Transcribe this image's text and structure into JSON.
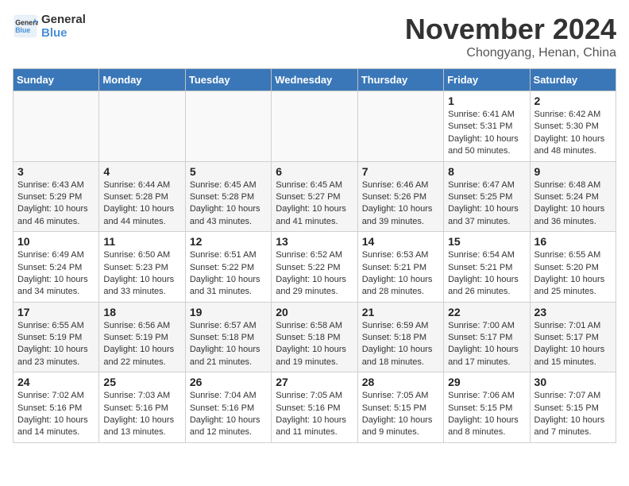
{
  "logo": {
    "line1": "General",
    "line2": "Blue"
  },
  "title": "November 2024",
  "location": "Chongyang, Henan, China",
  "weekdays": [
    "Sunday",
    "Monday",
    "Tuesday",
    "Wednesday",
    "Thursday",
    "Friday",
    "Saturday"
  ],
  "weeks": [
    [
      {
        "day": "",
        "info": ""
      },
      {
        "day": "",
        "info": ""
      },
      {
        "day": "",
        "info": ""
      },
      {
        "day": "",
        "info": ""
      },
      {
        "day": "",
        "info": ""
      },
      {
        "day": "1",
        "info": "Sunrise: 6:41 AM\nSunset: 5:31 PM\nDaylight: 10 hours\nand 50 minutes."
      },
      {
        "day": "2",
        "info": "Sunrise: 6:42 AM\nSunset: 5:30 PM\nDaylight: 10 hours\nand 48 minutes."
      }
    ],
    [
      {
        "day": "3",
        "info": "Sunrise: 6:43 AM\nSunset: 5:29 PM\nDaylight: 10 hours\nand 46 minutes."
      },
      {
        "day": "4",
        "info": "Sunrise: 6:44 AM\nSunset: 5:28 PM\nDaylight: 10 hours\nand 44 minutes."
      },
      {
        "day": "5",
        "info": "Sunrise: 6:45 AM\nSunset: 5:28 PM\nDaylight: 10 hours\nand 43 minutes."
      },
      {
        "day": "6",
        "info": "Sunrise: 6:45 AM\nSunset: 5:27 PM\nDaylight: 10 hours\nand 41 minutes."
      },
      {
        "day": "7",
        "info": "Sunrise: 6:46 AM\nSunset: 5:26 PM\nDaylight: 10 hours\nand 39 minutes."
      },
      {
        "day": "8",
        "info": "Sunrise: 6:47 AM\nSunset: 5:25 PM\nDaylight: 10 hours\nand 37 minutes."
      },
      {
        "day": "9",
        "info": "Sunrise: 6:48 AM\nSunset: 5:24 PM\nDaylight: 10 hours\nand 36 minutes."
      }
    ],
    [
      {
        "day": "10",
        "info": "Sunrise: 6:49 AM\nSunset: 5:24 PM\nDaylight: 10 hours\nand 34 minutes."
      },
      {
        "day": "11",
        "info": "Sunrise: 6:50 AM\nSunset: 5:23 PM\nDaylight: 10 hours\nand 33 minutes."
      },
      {
        "day": "12",
        "info": "Sunrise: 6:51 AM\nSunset: 5:22 PM\nDaylight: 10 hours\nand 31 minutes."
      },
      {
        "day": "13",
        "info": "Sunrise: 6:52 AM\nSunset: 5:22 PM\nDaylight: 10 hours\nand 29 minutes."
      },
      {
        "day": "14",
        "info": "Sunrise: 6:53 AM\nSunset: 5:21 PM\nDaylight: 10 hours\nand 28 minutes."
      },
      {
        "day": "15",
        "info": "Sunrise: 6:54 AM\nSunset: 5:21 PM\nDaylight: 10 hours\nand 26 minutes."
      },
      {
        "day": "16",
        "info": "Sunrise: 6:55 AM\nSunset: 5:20 PM\nDaylight: 10 hours\nand 25 minutes."
      }
    ],
    [
      {
        "day": "17",
        "info": "Sunrise: 6:55 AM\nSunset: 5:19 PM\nDaylight: 10 hours\nand 23 minutes."
      },
      {
        "day": "18",
        "info": "Sunrise: 6:56 AM\nSunset: 5:19 PM\nDaylight: 10 hours\nand 22 minutes."
      },
      {
        "day": "19",
        "info": "Sunrise: 6:57 AM\nSunset: 5:18 PM\nDaylight: 10 hours\nand 21 minutes."
      },
      {
        "day": "20",
        "info": "Sunrise: 6:58 AM\nSunset: 5:18 PM\nDaylight: 10 hours\nand 19 minutes."
      },
      {
        "day": "21",
        "info": "Sunrise: 6:59 AM\nSunset: 5:18 PM\nDaylight: 10 hours\nand 18 minutes."
      },
      {
        "day": "22",
        "info": "Sunrise: 7:00 AM\nSunset: 5:17 PM\nDaylight: 10 hours\nand 17 minutes."
      },
      {
        "day": "23",
        "info": "Sunrise: 7:01 AM\nSunset: 5:17 PM\nDaylight: 10 hours\nand 15 minutes."
      }
    ],
    [
      {
        "day": "24",
        "info": "Sunrise: 7:02 AM\nSunset: 5:16 PM\nDaylight: 10 hours\nand 14 minutes."
      },
      {
        "day": "25",
        "info": "Sunrise: 7:03 AM\nSunset: 5:16 PM\nDaylight: 10 hours\nand 13 minutes."
      },
      {
        "day": "26",
        "info": "Sunrise: 7:04 AM\nSunset: 5:16 PM\nDaylight: 10 hours\nand 12 minutes."
      },
      {
        "day": "27",
        "info": "Sunrise: 7:05 AM\nSunset: 5:16 PM\nDaylight: 10 hours\nand 11 minutes."
      },
      {
        "day": "28",
        "info": "Sunrise: 7:05 AM\nSunset: 5:15 PM\nDaylight: 10 hours\nand 9 minutes."
      },
      {
        "day": "29",
        "info": "Sunrise: 7:06 AM\nSunset: 5:15 PM\nDaylight: 10 hours\nand 8 minutes."
      },
      {
        "day": "30",
        "info": "Sunrise: 7:07 AM\nSunset: 5:15 PM\nDaylight: 10 hours\nand 7 minutes."
      }
    ]
  ]
}
